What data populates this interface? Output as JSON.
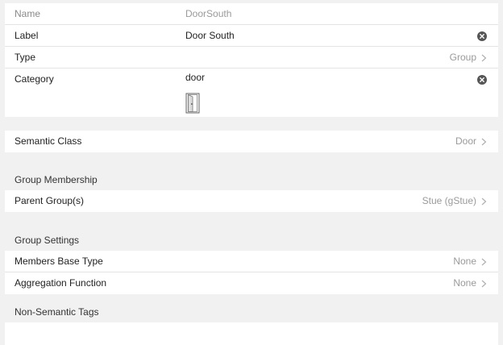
{
  "item": {
    "name_label": "Name",
    "name_value": "DoorSouth",
    "label_label": "Label",
    "label_value": "Door South",
    "type_label": "Type",
    "type_value": "Group",
    "category_label": "Category",
    "category_value": "door",
    "category_icon": "door-icon"
  },
  "semantic": {
    "class_label": "Semantic Class",
    "class_value": "Door"
  },
  "membership": {
    "title": "Group Membership",
    "parent_label": "Parent Group(s)",
    "parent_value": "Stue (gStue)"
  },
  "settings": {
    "title": "Group Settings",
    "base_type_label": "Members Base Type",
    "base_type_value": "None",
    "aggregation_label": "Aggregation Function",
    "aggregation_value": "None"
  },
  "tags": {
    "title": "Non-Semantic Tags"
  },
  "colors": {
    "background": "#f1f1f1",
    "panel": "#ffffff",
    "muted_text": "#9a9a9a",
    "clear_icon": "#555555"
  }
}
